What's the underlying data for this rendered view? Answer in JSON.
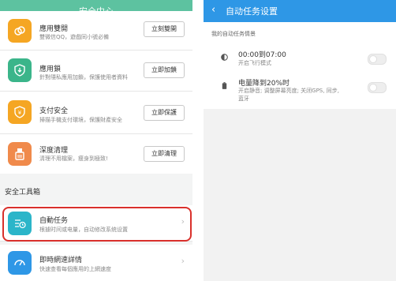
{
  "left": {
    "header_title": "安全中心",
    "rows": [
      {
        "title": "應用雙開",
        "subtitle": "雙微信QQ，遊戲同小號必備",
        "button": "立刻雙開",
        "color": "#f5a623",
        "icon": "dual-apps-icon"
      },
      {
        "title": "應用鎖",
        "subtitle": "針對隱私應用加鎖，保護使用者資料",
        "button": "立即加鎖",
        "color": "#3bb58a",
        "icon": "app-lock-icon"
      },
      {
        "title": "支付安全",
        "subtitle": "掃描手機支付環境，保護財產安全",
        "button": "立即保護",
        "color": "#f5a623",
        "icon": "payment-security-icon"
      },
      {
        "title": "深度清理",
        "subtitle": "清理不用檔案，瘦身到極致!",
        "button": "立即清理",
        "color": "#f08a4b",
        "icon": "deep-clean-icon"
      }
    ],
    "section_label": "安全工具箱",
    "tools": [
      {
        "title": "自動任务",
        "subtitle": "根據时间或电量，自动修改系统设置",
        "color": "#2bb5c9",
        "icon": "auto-task-icon"
      },
      {
        "title": "即時網速詳情",
        "subtitle": "快速查看每個應用的上網速度",
        "color": "#2e97e6",
        "icon": "network-speed-icon"
      }
    ],
    "chevron": "›"
  },
  "right": {
    "header_title": "自动任务设置",
    "back": "‹",
    "section_label": "我的自动任务情景",
    "tasks": [
      {
        "title": "00:00到07:00",
        "subtitle": "开启飞行模式",
        "icon": "night-schedule-icon"
      },
      {
        "title": "电量降到20%时",
        "subtitle_line1": "开启静音; 调整屏幕亮度; 关闭GPS, 同步,",
        "subtitle_line2": "蓝牙",
        "icon": "battery-icon"
      }
    ]
  }
}
